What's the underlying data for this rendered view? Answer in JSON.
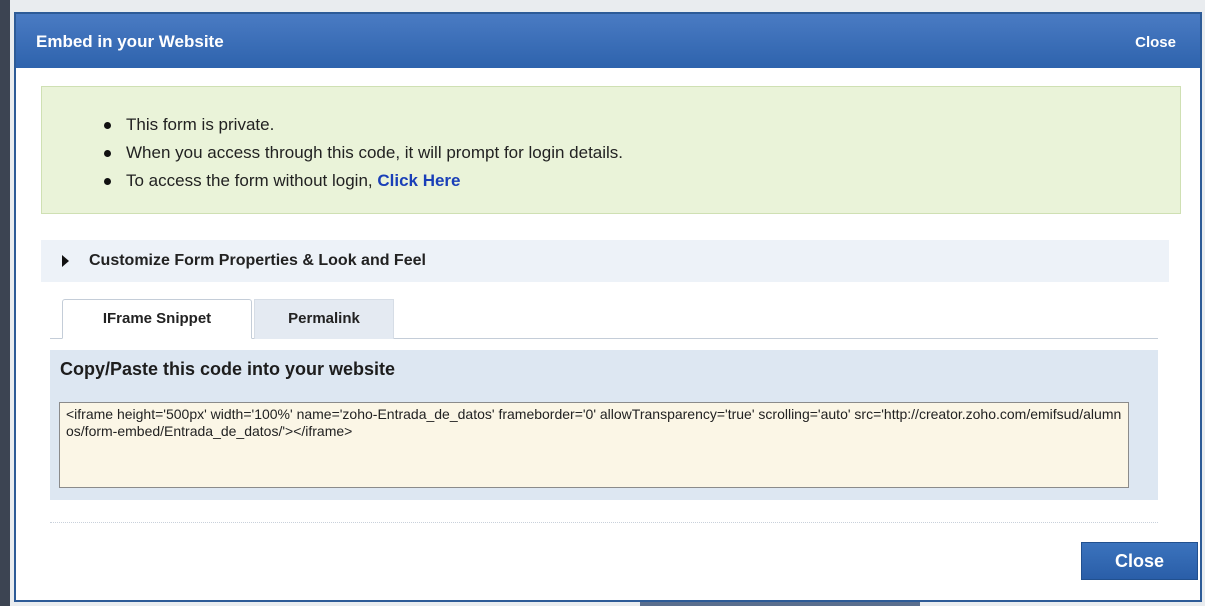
{
  "dialog": {
    "title": "Embed in your Website",
    "close_link": "Close"
  },
  "notice": {
    "items": [
      "This form is private.",
      "When you access through this code, it will prompt for login details.",
      "To access the form without login, "
    ],
    "link_text": "Click Here"
  },
  "customize": {
    "label": "Customize Form Properties & Look and Feel"
  },
  "tabs": [
    {
      "label": "IFrame Snippet",
      "active": true
    },
    {
      "label": "Permalink",
      "active": false
    }
  ],
  "code_panel": {
    "heading": "Copy/Paste this code into your website",
    "code": "<iframe height='500px' width='100%' name='zoho-Entrada_de_datos' frameborder='0' allowTransparency='true' scrolling='auto' src='http://creator.zoho.com/emifsud/alumnos/form-embed/Entrada_de_datos/'></iframe>"
  },
  "footer": {
    "close_button": "Close"
  },
  "colors": {
    "titlebar": "#2e63ad",
    "notice_bg": "#eaf3d9",
    "link": "#1a3fb8",
    "code_bg": "#fbf6e6"
  }
}
